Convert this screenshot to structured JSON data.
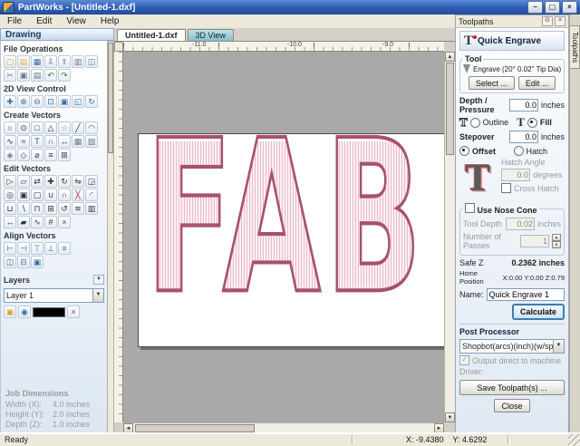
{
  "window": {
    "title": "PartWorks - [Untitled-1.dxf]",
    "menu_items": [
      "File",
      "Edit",
      "View",
      "Help"
    ]
  },
  "glyphs": {
    "minimize": "−",
    "maximize": "▢",
    "close": "×",
    "down_arrow": "▼",
    "up_arrow": "▲",
    "left_arrow": "◄",
    "right_arrow": "►",
    "check": "✓",
    "pin": "⊙"
  },
  "colors": {
    "titlebar_blue": "#2d5cb2",
    "toolpath_pink": "#a85070",
    "calculate_focus_blue": "#3c7fb1",
    "tab_3d_teal": "#85bccd"
  },
  "drawing_panel": {
    "title": "Drawing",
    "sections": [
      {
        "label": "File Operations",
        "icon_rows": [
          [
            [
              "new-drawing",
              "▢",
              "#d8a62a"
            ],
            [
              "open-drawing",
              "▤",
              "#e0b23a"
            ],
            [
              "save-drawing",
              "▦",
              "#3a6ea5"
            ],
            [
              "import-vectors",
              "⇩",
              "#6a52b8"
            ],
            [
              "export-vectors",
              "⇧",
              "#6a52b8"
            ],
            [
              "print-drawing",
              "▥",
              "#667788"
            ],
            [
              "print-preview",
              "◫",
              "#667788"
            ]
          ],
          [
            [
              "cut",
              "✂",
              "#667788"
            ],
            [
              "copy",
              "▣",
              "#667788"
            ],
            [
              "paste",
              "▤",
              "#667788"
            ],
            [
              "undo",
              "↶",
              "#2a7a2a"
            ],
            [
              "redo",
              "↷",
              "#2a7a2a"
            ]
          ]
        ]
      },
      {
        "label": "2D View Control",
        "icon_rows": [
          [
            [
              "pan",
              "✚",
              "#3a6ea5"
            ],
            [
              "zoom-in",
              "⊕",
              "#3a6ea5"
            ],
            [
              "zoom-out",
              "⊖",
              "#3a6ea5"
            ],
            [
              "zoom-window",
              "⊡",
              "#3a6ea5"
            ],
            [
              "zoom-extents",
              "▣",
              "#3a6ea5"
            ],
            [
              "zoom-selected",
              "◱",
              "#3a6ea5"
            ],
            [
              "refresh-view",
              "↻",
              "#3a6ea5"
            ]
          ]
        ]
      },
      {
        "label": "Create Vectors",
        "icon_rows": [
          [
            [
              "draw-circle",
              "○",
              "#333333"
            ],
            [
              "draw-ellipse",
              "⊙",
              "#333333"
            ],
            [
              "draw-rectangle",
              "□",
              "#333333"
            ],
            [
              "draw-polygon",
              "△",
              "#333333"
            ],
            [
              "draw-star",
              "☆",
              "#b8862a"
            ],
            [
              "draw-polyline",
              "╱",
              "#333333"
            ],
            [
              "draw-arc",
              "◠",
              "#333333"
            ]
          ],
          [
            [
              "draw-curve",
              "∿",
              "#333333"
            ],
            [
              "draw-freehand",
              "≈",
              "#333333"
            ],
            [
              "draw-text",
              "T",
              "#2255bb"
            ],
            [
              "text-on-curve",
              "∩",
              "#2255bb"
            ],
            [
              "dimension",
              "↔",
              "#333333"
            ],
            [
              "grid",
              "▦",
              "#667788"
            ],
            [
              "import-bitmap",
              "▧",
              "#667788"
            ]
          ],
          [
            [
              "trace-bitmap",
              "◈",
              "#667788"
            ],
            [
              "edit-nodes",
              "◇",
              "#333333"
            ],
            [
              "measure",
              "⌀",
              "#333333"
            ],
            [
              "ruler",
              "≡",
              "#333333"
            ],
            [
              "snap-grid",
              "⊞",
              "#333333"
            ]
          ]
        ]
      },
      {
        "label": "Edit Vectors",
        "icon_rows": [
          [
            [
              "select",
              "▷",
              "#333333"
            ],
            [
              "node-edit",
              "▱",
              "#333333"
            ],
            [
              "transform",
              "⇄",
              "#333333"
            ],
            [
              "move",
              "✚",
              "#333333"
            ],
            [
              "rotate",
              "↻",
              "#333333"
            ],
            [
              "mirror",
              "⇋",
              "#333333"
            ],
            [
              "scale",
              "◲",
              "#333333"
            ]
          ],
          [
            [
              "offset",
              "◎",
              "#333333"
            ],
            [
              "group",
              "▣",
              "#333333"
            ],
            [
              "ungroup",
              "▢",
              "#333333"
            ],
            [
              "join-vectors",
              "∪",
              "#333333"
            ],
            [
              "close-vectors",
              "∩",
              "#333333"
            ],
            [
              "trim",
              "╳",
              "#a03030"
            ],
            [
              "fillet",
              "◜",
              "#333333"
            ]
          ],
          [
            [
              "weld",
              "⊔",
              "#333333"
            ],
            [
              "subtract",
              "∖",
              "#333333"
            ],
            [
              "intersect",
              "⊓",
              "#333333"
            ],
            [
              "array-copy",
              "⊞",
              "#333333"
            ],
            [
              "rotate-copy",
              "↺",
              "#333333"
            ],
            [
              "paste-along",
              "≋",
              "#333333"
            ],
            [
              "nest",
              "▥",
              "#333333"
            ]
          ],
          [
            [
              "stretch",
              "↔",
              "#333333"
            ],
            [
              "distort",
              "▰",
              "#333333"
            ],
            [
              "smooth",
              "∿",
              "#333333"
            ],
            [
              "snap-objects",
              "#",
              "#333333"
            ],
            [
              "delete-vector",
              "×",
              "#a03030"
            ]
          ]
        ]
      },
      {
        "label": "Align Vectors",
        "icon_rows": [
          [
            [
              "align-left",
              "⊢",
              "#3a6ea5"
            ],
            [
              "align-right",
              "⊣",
              "#3a6ea5"
            ],
            [
              "align-top",
              "⊤",
              "#3a6ea5"
            ],
            [
              "align-bottom",
              "⊥",
              "#3a6ea5"
            ],
            [
              "align-center",
              "≡",
              "#3a6ea5"
            ]
          ],
          [
            [
              "center-horizontal",
              "◫",
              "#3a6ea5"
            ],
            [
              "center-vertical",
              "⊟",
              "#3a6ea5"
            ],
            [
              "center-in-material",
              "▣",
              "#3a6ea5"
            ]
          ]
        ]
      }
    ],
    "layers": {
      "label": "Layers",
      "selected_layer": "Layer 1",
      "controls": [
        [
          "new-layer",
          "▣",
          "#d8a62a"
        ],
        [
          "layer-visibility",
          "◉",
          "#3a6ea5"
        ],
        [
          "layer-color",
          "",
          "#000000"
        ],
        [
          "delete-layer",
          "×",
          "#a03030"
        ]
      ]
    },
    "job_dimensions": {
      "label": "Job Dimensions",
      "rows": [
        {
          "label": "Width (X):",
          "value": "4.0 inches"
        },
        {
          "label": "Height (Y):",
          "value": "2.0 inches"
        },
        {
          "label": "Depth (Z):",
          "value": "1.0 inches"
        }
      ]
    }
  },
  "document": {
    "tabs": [
      {
        "label": "Untitled-1.dxf",
        "active": true,
        "accent": ""
      },
      {
        "label": "3D View",
        "active": false,
        "accent": "teal"
      }
    ],
    "ruler_labels": [
      "-11.0",
      "-10.0",
      "-9.0"
    ],
    "canvas_text": "FAB"
  },
  "toolpaths_panel": {
    "title": "Toolpaths",
    "side_tab": "Toolpaths",
    "form": {
      "heading": "Quick Engrave",
      "t_glyph": "T",
      "tool_group": {
        "label": "Tool",
        "tool_name": "Engrave (20° 0.02\" Tip Dia)",
        "select_button": "Select ...",
        "edit_button": "Edit ..."
      },
      "depth_pressure": {
        "label": "Depth / Pressure",
        "value": "0.0",
        "units": "inches"
      },
      "outline_fill": {
        "outline_label": "Outline",
        "fill_label": "Fill",
        "selected": "Fill"
      },
      "stepover": {
        "label": "Stepover",
        "value": "0.0",
        "units": "inches"
      },
      "fill_style": {
        "offset_label": "Offset",
        "hatch_label": "Hatch",
        "selected": "Offset",
        "hatch_angle_label": "Hatch Angle",
        "hatch_angle_value": "0.0",
        "hatch_angle_units": "degrees",
        "cross_hatch_label": "Cross Hatch"
      },
      "nose_cone": {
        "label": "Use Nose Cone",
        "checked": false,
        "tool_depth_label": "Tool Depth",
        "tool_depth_value": "0.02",
        "tool_depth_units": "inches",
        "passes_label": "Number of Passes",
        "passes_value": "1"
      },
      "safe_z": {
        "label": "Safe Z",
        "value": "0.2362 inches"
      },
      "home_position": {
        "label": "Home Position",
        "value": "X:0.00 Y:0.00 Z:0.79"
      },
      "name": {
        "label": "Name:",
        "value": "Quick Engrave 1"
      },
      "calculate_button": "Calculate",
      "post_processor": {
        "label": "Post Processor",
        "selected": "Shopbot(arcs)(inch)(w/speed)(*.sbp)",
        "output_direct_label": "Output direct to machine",
        "output_direct_checked": true,
        "driver_label": "Driver:",
        "save_button": "Save Toolpath(s) ...",
        "close_button": "Close"
      }
    }
  },
  "status_bar": {
    "ready": "Ready",
    "coordinates": "X: -9.4380    Y: 4.6292"
  }
}
